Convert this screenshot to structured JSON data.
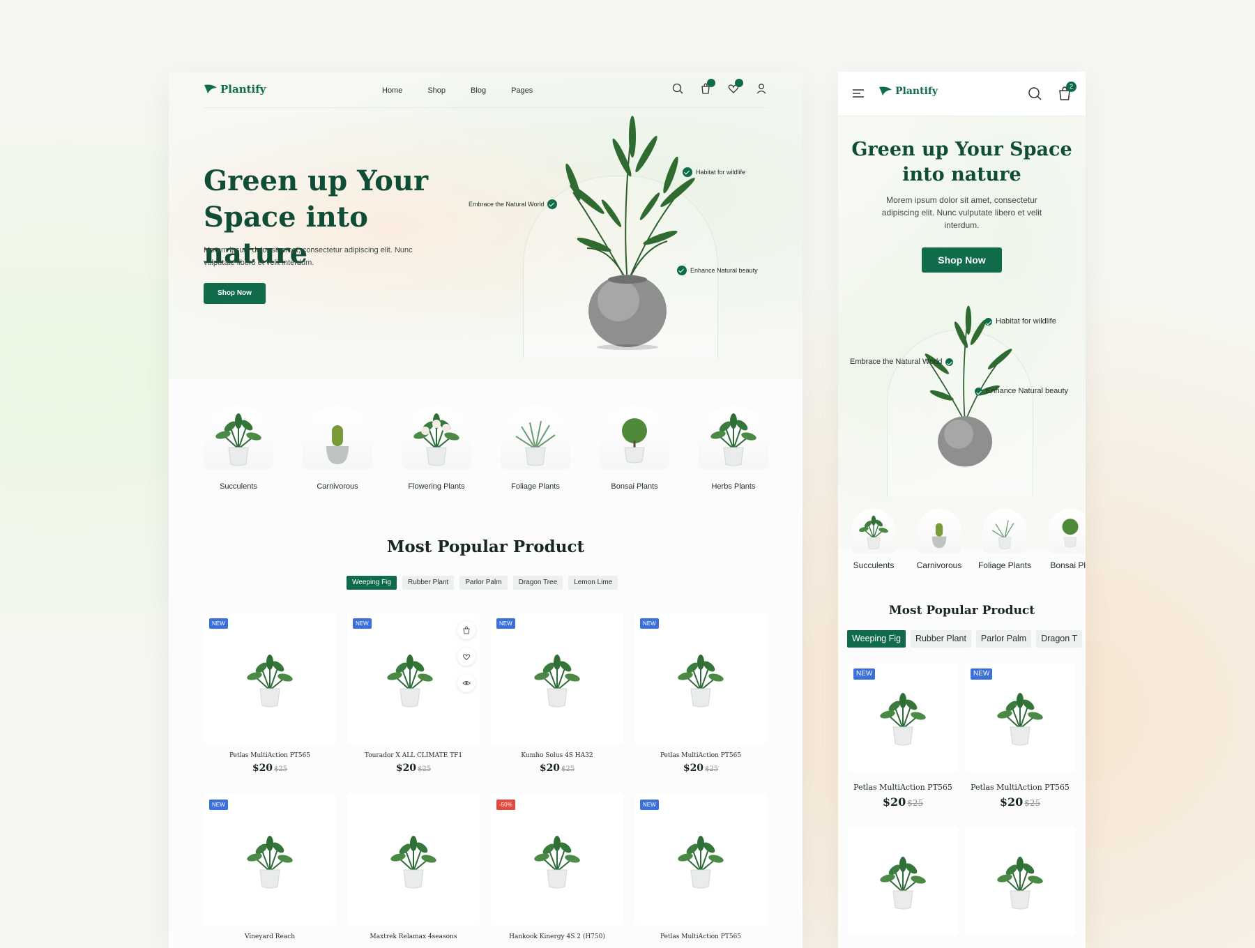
{
  "brand": "Plantify",
  "colors": {
    "primary": "#0f6b4a",
    "badge_new": "#3b6fd9",
    "badge_sale": "#e04a3f"
  },
  "desktop": {
    "nav": {
      "items": [
        "Home",
        "Shop",
        "Blog",
        "Pages"
      ]
    },
    "hero": {
      "title": "Green up Your Space into nature",
      "subtitle": "Morem ipsum dolor sit amet, consectetur adipiscing elit. Nunc vulputate libero et velit interdum.",
      "cta": "Shop Now",
      "tags": [
        "Habitat for wildlife",
        "Embrace the Natural World",
        "Enhance Natural beauty"
      ]
    },
    "categories": [
      "Succulents",
      "Carnivorous",
      "Flowering Plants",
      "Foliage Plants",
      "Bonsai Plants",
      "Herbs Plants"
    ],
    "popular": {
      "title": "Most Popular Product",
      "tabs": [
        "Weeping Fig",
        "Rubber Plant",
        "Parlor Palm",
        "Dragon Tree",
        "Lemon Lime"
      ],
      "products": [
        {
          "badge": "NEW",
          "name": "Petlas MultiAction PT565",
          "price": "$20",
          "old_price": "$25"
        },
        {
          "badge": "NEW",
          "name": "Tourador X ALL CLIMATE TF1",
          "price": "$20",
          "old_price": "$25"
        },
        {
          "badge": "NEW",
          "name": "Kumho Solus 4S HA32",
          "price": "$20",
          "old_price": "$25"
        },
        {
          "badge": "NEW",
          "name": "Petlas MultiAction PT565",
          "price": "$20",
          "old_price": "$25"
        },
        {
          "badge": "NEW",
          "name": "Vineyard Reach",
          "price": "",
          "old_price": ""
        },
        {
          "badge": "",
          "name": "Maxtrek Relamax 4seasons",
          "price": "",
          "old_price": ""
        },
        {
          "badge": "-50%",
          "name": "Hankook Kinergy 4S 2 (H750)",
          "price": "",
          "old_price": ""
        },
        {
          "badge": "NEW",
          "name": "Petlas MultiAction PT565",
          "price": "",
          "old_price": ""
        }
      ]
    }
  },
  "mobile": {
    "cart_count": "2",
    "hero": {
      "title": "Green up Your Space into nature",
      "subtitle": "Morem ipsum dolor sit amet, consectetur adipiscing elit. Nunc vulputate libero et velit interdum.",
      "cta": "Shop Now",
      "tags": [
        "Habitat for wildlife",
        "Embrace the Natural World",
        "Enhance Natural beauty"
      ]
    },
    "categories": [
      "Succulents",
      "Carnivorous",
      "Foliage Plants",
      "Bonsai Pla"
    ],
    "popular": {
      "title": "Most Popular Product",
      "tabs": [
        "Weeping Fig",
        "Rubber Plant",
        "Parlor Palm",
        "Dragon T"
      ],
      "products": [
        {
          "badge": "NEW",
          "name": "Petlas MultiAction PT565",
          "price": "$20",
          "old_price": "$25"
        },
        {
          "badge": "NEW",
          "name": "Petlas MultiAction PT565",
          "price": "$20",
          "old_price": "$25"
        },
        {
          "badge": "",
          "name": "",
          "price": "",
          "old_price": ""
        },
        {
          "badge": "",
          "name": "",
          "price": "",
          "old_price": ""
        }
      ]
    }
  }
}
